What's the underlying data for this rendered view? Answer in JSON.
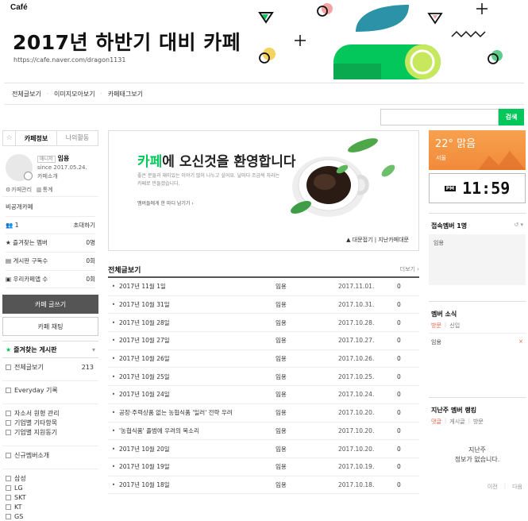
{
  "header": {
    "logo": "Café",
    "title": "2017년 하반기 대비 카페",
    "url": "https://cafe.naver.com/dragon1131"
  },
  "nav": {
    "items": [
      "전체글보기",
      "이미지모아보기",
      "카페태그보기"
    ]
  },
  "search": {
    "placeholder": "",
    "button": "검색"
  },
  "left": {
    "tabs": {
      "info": "카페정보",
      "activity": "나의활동"
    },
    "profile": {
      "badge": "매니저",
      "name": "임용",
      "since": "since 2017.05.24.",
      "intro": "카페소개"
    },
    "mgmt": {
      "manage": "카페관리",
      "stats": "통계"
    },
    "privacy": "비공개카페",
    "members": "1",
    "invite": "초대하기",
    "stats": [
      {
        "label": "즐겨찾는 멤버",
        "value": "0명"
      },
      {
        "label": "게시판 구독수",
        "value": "0회"
      },
      {
        "label": "우리카페앱 수",
        "value": "0회"
      }
    ],
    "write_btn": "카페 글쓰기",
    "chat_btn": "카페 채팅",
    "fav_boards": "즐겨찾는 게시판",
    "menu": {
      "all": "전체글보기",
      "all_count": "213",
      "group1": [
        "Everyday 기록"
      ],
      "group2": [
        "자소서 원형 관리",
        "기업별 기타항목",
        "기업별 지원동기"
      ],
      "group3": [
        "신규멤버소개"
      ],
      "group4": [
        "삼성",
        "LG",
        "SKT",
        "KT",
        "GS"
      ]
    }
  },
  "welcome": {
    "title_green": "카페",
    "title_rest": "에 오신것을 환영합니다",
    "desc": "좋은 분들과 재미있는 이야기 많이 나누고 싶어요. 날마다 조금씩 자라는 카페로 만들겠습니다.",
    "link": "멤버들에게 한 마디 남기기 ›",
    "footer": "▲ 대문접기 | 지난카페대문"
  },
  "list": {
    "title": "전체글보기",
    "more": "더보기 ›",
    "rows": [
      {
        "title": "2017년 11월 1일",
        "author": "임용",
        "date": "2017.11.01.",
        "views": "0"
      },
      {
        "title": "2017년 10월 31일",
        "author": "임용",
        "date": "2017.10.31.",
        "views": "0"
      },
      {
        "title": "2017년 10월 28일",
        "author": "임용",
        "date": "2017.10.28.",
        "views": "0"
      },
      {
        "title": "2017년 10월 27일",
        "author": "임용",
        "date": "2017.10.27.",
        "views": "0"
      },
      {
        "title": "2017년 10월 26일",
        "author": "임용",
        "date": "2017.10.26.",
        "views": "0"
      },
      {
        "title": "2017년 10월 25일",
        "author": "임용",
        "date": "2017.10.25.",
        "views": "0"
      },
      {
        "title": "2017년 10월 24일",
        "author": "임용",
        "date": "2017.10.24.",
        "views": "0"
      },
      {
        "title": "공장·주력상품 없는 농협식품 '일러' 전략 우려",
        "author": "임용",
        "date": "2017.10.20.",
        "views": "0"
      },
      {
        "title": "'농협식품' 졸범에 우려의 목소리",
        "author": "임용",
        "date": "2017.10.20.",
        "views": "0"
      },
      {
        "title": "2017년 10월 20일",
        "author": "임용",
        "date": "2017.10.20.",
        "views": "0"
      },
      {
        "title": "2017년 10월 19일",
        "author": "임용",
        "date": "2017.10.19.",
        "views": "0"
      },
      {
        "title": "2017년 10월 18일",
        "author": "임용",
        "date": "2017.10.18.",
        "views": "0"
      }
    ]
  },
  "right": {
    "weather": {
      "temp": "22° 맑음",
      "city": "서울"
    },
    "clock": {
      "ampm": "PM",
      "time": "11:59"
    },
    "online": {
      "title": "접속멤버 1명",
      "refresh": "↺ ▾",
      "member": "임용"
    },
    "news": {
      "title": "멤버 소식",
      "tab1": "방문",
      "tab2": "신입",
      "member": "임용",
      "close": "×"
    },
    "ranking": {
      "title": "지난주 멤버 랭킹",
      "tabs": [
        "댓글",
        "게시글",
        "방문"
      ],
      "empty": "지난주\n정보가 없습니다.",
      "prev": "이전",
      "next": "다음"
    }
  },
  "colors": {
    "brand": "#03c75a",
    "accent_orange": "#f28a3a",
    "accent_red": "#e65c3c"
  }
}
